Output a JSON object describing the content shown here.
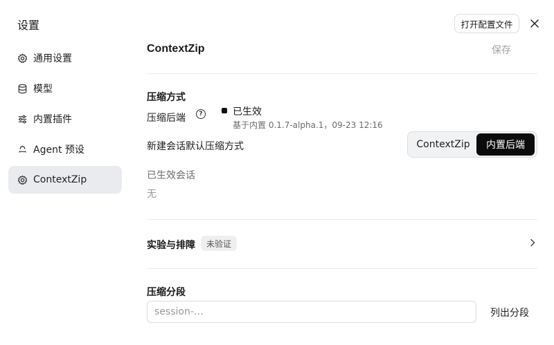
{
  "dialog": {
    "title": "设置",
    "open_config_label": "打开配置文件"
  },
  "sidebar": {
    "items": [
      {
        "label": "通用设置",
        "icon": "gear-icon"
      },
      {
        "label": "模型",
        "icon": "database-icon"
      },
      {
        "label": "内置插件",
        "icon": "sliders-icon"
      },
      {
        "label": "Agent 预设",
        "icon": "recycle-icon"
      },
      {
        "label": "ContextZip",
        "icon": "gear-icon"
      }
    ],
    "active_index": 4
  },
  "main": {
    "title": "ContextZip",
    "save_label": "保存",
    "compression": {
      "section_title": "压缩方式",
      "backend_label": "压缩后端",
      "status": "已生效",
      "status_detail": "基于内置 0.1.7-alpha.1，09-23 12:16",
      "default_method_label": "新建会话默认压缩方式",
      "options": [
        "ContextZip",
        "内置后端"
      ],
      "selected_option": "内置后端",
      "active_sessions_label": "已生效会话",
      "active_sessions_value": "无"
    },
    "experiment": {
      "title": "实验与排障",
      "badge": "未验证"
    },
    "segments": {
      "title": "压缩分段",
      "input_value": "",
      "input_placeholder": "session-…",
      "list_button": "列出分段"
    }
  },
  "colors": {
    "active_sidebar_bg": "#e9ebef",
    "selected_segment_bg": "#0c0c0c",
    "muted_text": "#a3a3a3"
  }
}
